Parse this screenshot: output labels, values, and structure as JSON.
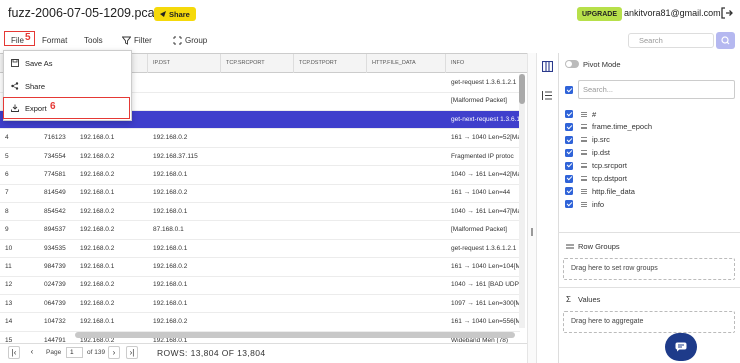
{
  "header": {
    "file_title": "fuzz-2006-07-05-1209.pcap",
    "share_label": "Share",
    "upgrade_label": "UPGRADE",
    "user_email": "ankitvora81@gmail.com"
  },
  "menubar": {
    "file": "File",
    "format": "Format",
    "tools": "Tools",
    "filter": "Filter",
    "group": "Group"
  },
  "annotations": {
    "file_step": "5",
    "export_step": "6"
  },
  "search": {
    "placeholder": "Search"
  },
  "file_menu": {
    "save_as": "Save As",
    "share": "Share",
    "export": "Export"
  },
  "grid": {
    "columns": [
      "",
      "",
      "IP.SRC",
      "IP.DST",
      "TCP.SRCPORT",
      "TCP.DSTPORT",
      "HTTP.FILE_DATA",
      "INFO"
    ],
    "rows": [
      {
        "num": "",
        "time": "",
        "src": "192.168.0.1",
        "dst": "",
        "srcport": "",
        "dstport": "",
        "http": "",
        "info": "get-request 1.3.6.1.2.1",
        "selected": false
      },
      {
        "num": "",
        "time": "",
        "src": "192.168.0.2",
        "dst": "",
        "srcport": "",
        "dstport": "",
        "http": "",
        "info": "[Malformed Packet]",
        "selected": false
      },
      {
        "num": "",
        "time": "",
        "src": "192.168.0.1",
        "dst": "",
        "srcport": "",
        "dstport": "",
        "http": "",
        "info": "get-next-request 1.3.6.1",
        "selected": true
      },
      {
        "num": "4",
        "time": "716123",
        "src": "192.168.0.1",
        "dst": "192.168.0.2",
        "srcport": "",
        "dstport": "",
        "http": "",
        "info": "161 → 1040 Len=52[Ma",
        "selected": false
      },
      {
        "num": "5",
        "time": "734554",
        "src": "192.168.0.2",
        "dst": "192.168.37.115",
        "srcport": "",
        "dstport": "",
        "http": "",
        "info": "Fragmented IP protoc",
        "selected": false
      },
      {
        "num": "6",
        "time": "774581",
        "src": "192.168.0.2",
        "dst": "192.168.0.1",
        "srcport": "",
        "dstport": "",
        "http": "",
        "info": "1040 → 161 Len=42[Ma",
        "selected": false
      },
      {
        "num": "7",
        "time": "814549",
        "src": "192.168.0.1",
        "dst": "192.168.0.2",
        "srcport": "",
        "dstport": "",
        "http": "",
        "info": "161 → 1040 Len=44",
        "selected": false
      },
      {
        "num": "8",
        "time": "854542",
        "src": "192.168.0.2",
        "dst": "192.168.0.1",
        "srcport": "",
        "dstport": "",
        "http": "",
        "info": "1040 → 161 Len=47[Ma",
        "selected": false
      },
      {
        "num": "9",
        "time": "894537",
        "src": "192.168.0.2",
        "dst": "87.168.0.1",
        "srcport": "",
        "dstport": "",
        "http": "",
        "info": "[Malformed Packet]",
        "selected": false
      },
      {
        "num": "10",
        "time": "934535",
        "src": "192.168.0.2",
        "dst": "192.168.0.1",
        "srcport": "",
        "dstport": "",
        "http": "",
        "info": "get-request 1.3.6.1.2.1",
        "selected": false
      },
      {
        "num": "11",
        "time": "984739",
        "src": "192.168.0.1",
        "dst": "192.168.0.2",
        "srcport": "",
        "dstport": "",
        "http": "",
        "info": "161 → 1040 Len=104[M",
        "selected": false
      },
      {
        "num": "12",
        "time": "024739",
        "src": "192.168.0.2",
        "dst": "192.168.0.1",
        "srcport": "",
        "dstport": "",
        "http": "",
        "info": "1040 → 161 [BAD UDP",
        "selected": false
      },
      {
        "num": "13",
        "time": "064739",
        "src": "192.168.0.2",
        "dst": "192.168.0.1",
        "srcport": "",
        "dstport": "",
        "http": "",
        "info": "1097 → 161 Len=300[M",
        "selected": false
      },
      {
        "num": "14",
        "time": "104732",
        "src": "192.168.0.1",
        "dst": "192.168.0.2",
        "srcport": "",
        "dstport": "",
        "http": "",
        "info": "161 → 1040 Len=556[Ma",
        "selected": false
      },
      {
        "num": "15",
        "time": "144791",
        "src": "192.168.0.2",
        "dst": "192.168.0.1",
        "srcport": "",
        "dstport": "",
        "http": "",
        "info": "Wideband Men (78)",
        "selected": false
      }
    ]
  },
  "pagination": {
    "page_label": "Page",
    "page": "1",
    "of_total": "of 139",
    "rows_text": "ROWS: 13,804 OF 13,804"
  },
  "panel": {
    "pivot_label": "Pivot Mode",
    "search_placeholder": "Search...",
    "columns": [
      "#",
      "frame.time_epoch",
      "ip.src",
      "ip.dst",
      "tcp.srcport",
      "tcp.dstport",
      "http.file_data",
      "info"
    ],
    "row_groups": "Row Groups",
    "row_groups_hint": "Drag here to set row groups",
    "values": "Values",
    "values_hint": "Drag here to aggregate"
  }
}
